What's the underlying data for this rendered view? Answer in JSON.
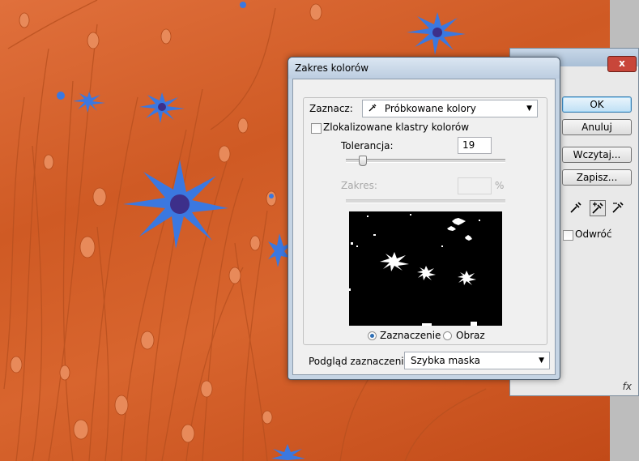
{
  "dialog": {
    "title": "Zakres kolorów",
    "select_label": "Zaznacz:",
    "select_value": "Próbkowane kolory",
    "localized_clusters_label": "Zlokalizowane klastry kolorów",
    "localized_clusters_checked": false,
    "tolerance_label": "Tolerancja:",
    "tolerance_value": "19",
    "tolerance_fraction": 0.1,
    "range_label": "Zakres:",
    "range_unit": "%",
    "mode_selection_label": "Zaznaczenie",
    "mode_image_label": "Obraz",
    "mode_selected": "Zaznaczenie",
    "preview_label": "Podgląd zaznaczenia:",
    "preview_value": "Szybka maska",
    "buttons": {
      "ok": "OK",
      "cancel": "Anuluj",
      "load": "Wczytaj...",
      "save": "Zapisz..."
    },
    "invert_label": "Odwróć",
    "invert_checked": false,
    "eyedropper_tools": [
      "eyedropper-icon",
      "eyedropper-plus-icon",
      "eyedropper-minus-icon"
    ],
    "active_tool": "eyedropper-plus-icon"
  },
  "background_window": {
    "close_symbol": "x",
    "footer_icon": "fx"
  },
  "colors": {
    "photo": "#d8652e",
    "flowers": "#3b78e0",
    "dialog_frame": "#c5d4e4",
    "ok_accent": "#3c7fb1"
  }
}
